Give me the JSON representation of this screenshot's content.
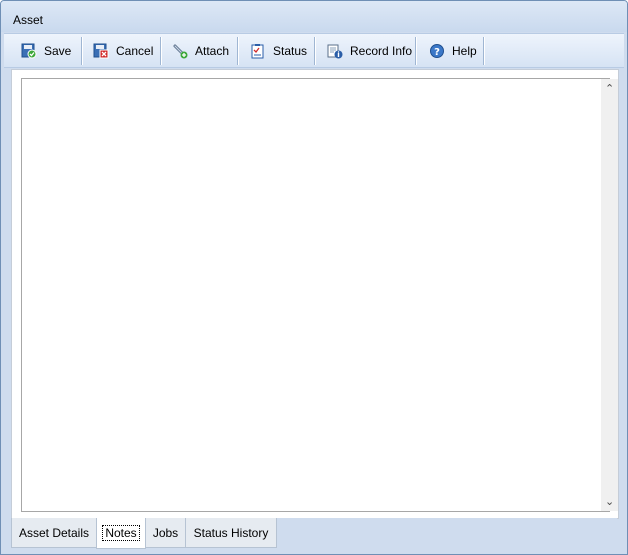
{
  "window": {
    "title": "Asset"
  },
  "toolbar": {
    "buttons": [
      {
        "label": "Save",
        "icon": "save-icon"
      },
      {
        "label": "Cancel",
        "icon": "cancel-icon"
      },
      {
        "label": "Attach",
        "icon": "attach-icon"
      },
      {
        "label": "Status",
        "icon": "status-icon"
      },
      {
        "label": "Record Info",
        "icon": "record-info-icon"
      },
      {
        "label": "Help",
        "icon": "help-icon"
      }
    ]
  },
  "notes": {
    "value": ""
  },
  "tabs": [
    {
      "label": "Asset Details",
      "active": false
    },
    {
      "label": "Notes",
      "active": true
    },
    {
      "label": "Jobs",
      "active": false
    },
    {
      "label": "Status History",
      "active": false
    }
  ],
  "colors": {
    "window_bg": "#cfdcee",
    "toolbar_bg": "#dfe9f6",
    "accent_blue": "#2a5ea8"
  }
}
